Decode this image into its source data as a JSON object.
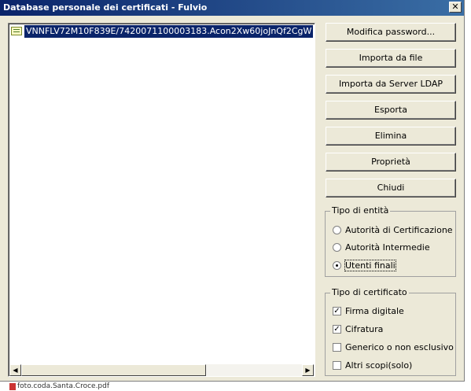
{
  "window": {
    "title": "Database personale dei certificati - Fulvio",
    "close_glyph": "✕"
  },
  "certificates": [
    {
      "label": "VNNFLV72M10F839E/7420071100003183.Acon2Xw60joJnQf2CgW",
      "selected": true
    }
  ],
  "buttons": {
    "change_password": "Modifica password...",
    "import_file": "Importa da file",
    "import_ldap": "Importa da Server LDAP",
    "export": "Esporta",
    "delete": "Elimina",
    "properties": "Proprietà",
    "close": "Chiudi"
  },
  "entity_type": {
    "legend": "Tipo di entità",
    "options": [
      {
        "label": "Autorità di Certificazione",
        "selected": false
      },
      {
        "label": "Autorità Intermedie",
        "selected": false
      },
      {
        "label": "Utenti finali",
        "selected": true
      }
    ]
  },
  "certificate_type": {
    "legend": "Tipo di certificato",
    "options": [
      {
        "label": "Firma digitale",
        "checked": true,
        "mark": "✓"
      },
      {
        "label": "Cifratura",
        "checked": true,
        "mark": "✓"
      },
      {
        "label": "Generico o non esclusivo",
        "checked": false,
        "mark": ""
      },
      {
        "label": "Altri scopi(solo)",
        "checked": false,
        "mark": ""
      }
    ]
  },
  "scrollbar": {
    "left_arrow": "◀",
    "right_arrow": "▶"
  },
  "background": {
    "file_text": "foto.coda.Santa.Croce.pdf"
  },
  "colors": {
    "title_start": "#0a246a",
    "title_end": "#3a6ea5",
    "selection": "#0a246a",
    "face": "#ece9d8"
  }
}
